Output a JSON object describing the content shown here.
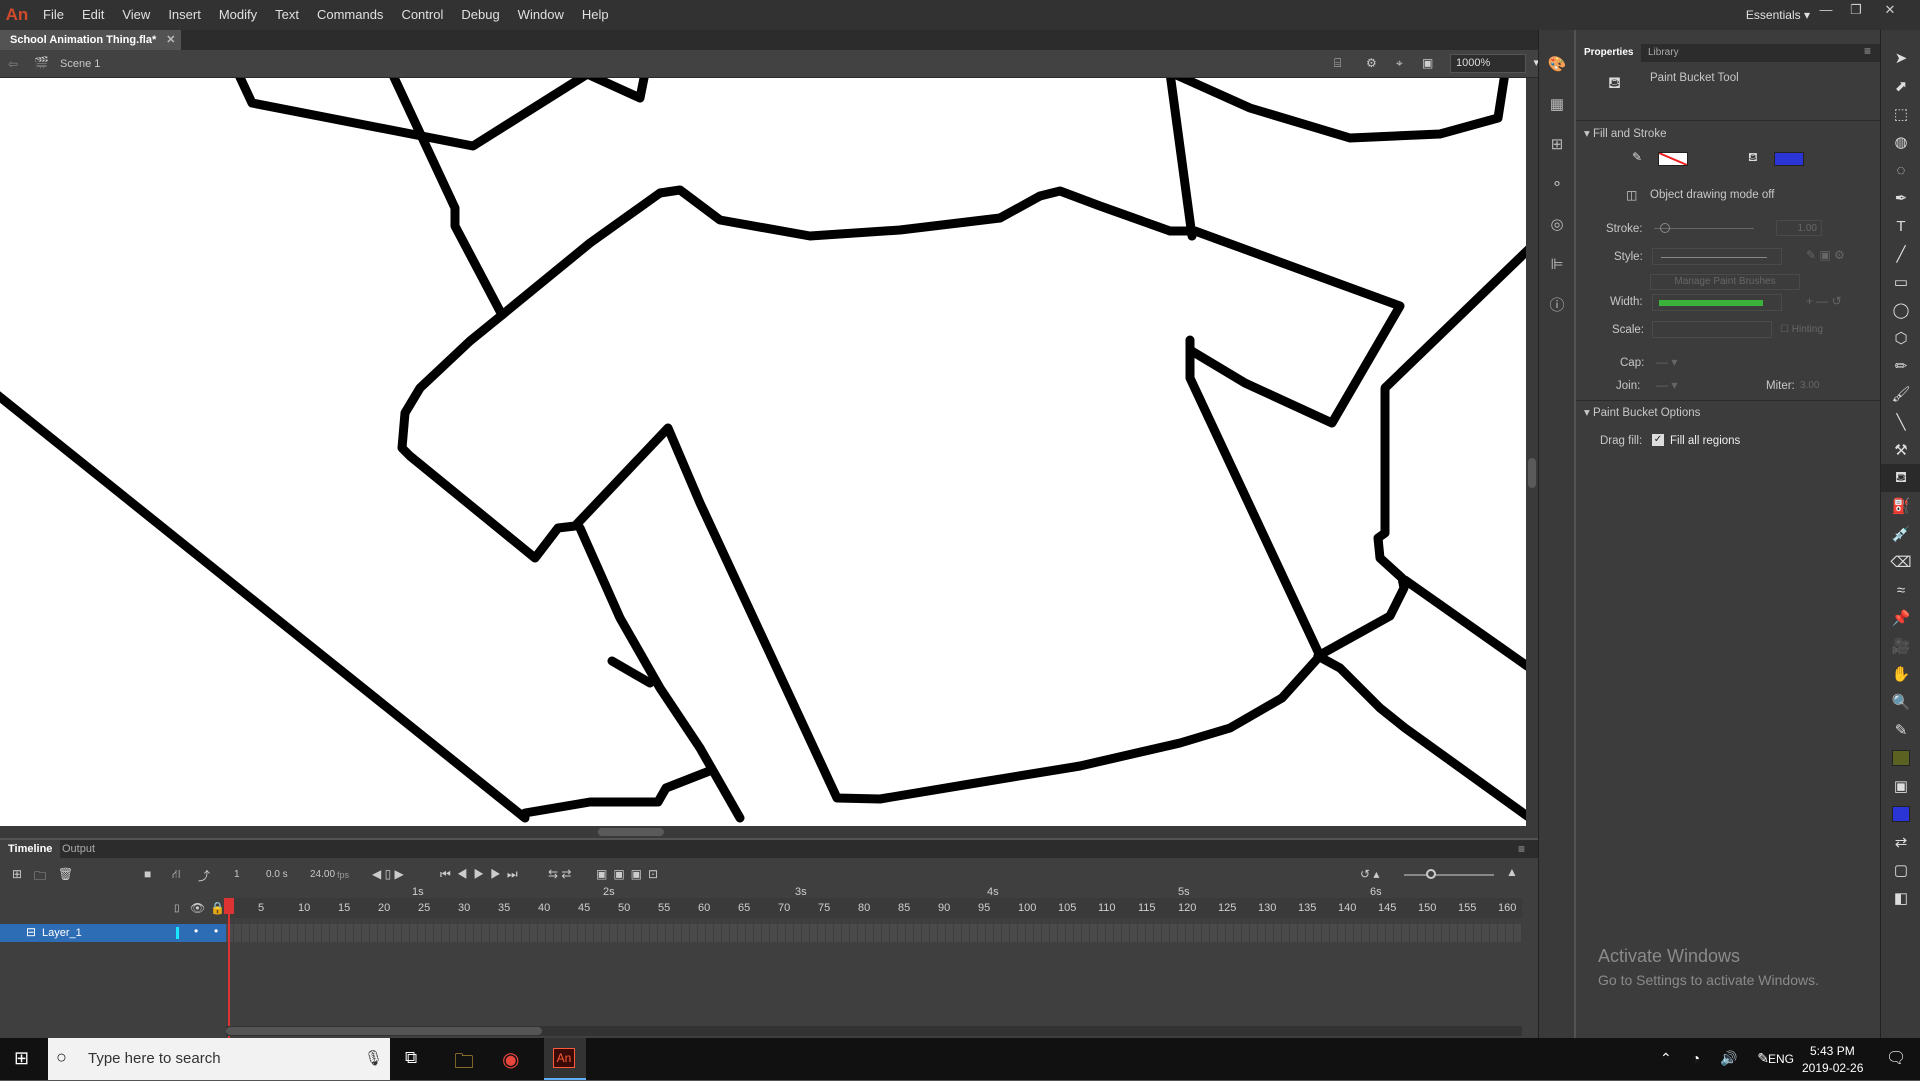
{
  "menu": {
    "logo": "An",
    "items": [
      "File",
      "Edit",
      "View",
      "Insert",
      "Modify",
      "Text",
      "Commands",
      "Control",
      "Debug",
      "Window",
      "Help"
    ],
    "workspace": "Essentials"
  },
  "document": {
    "tab": "School Animation Thing.fla*",
    "scene": "Scene 1",
    "zoom": "1000%"
  },
  "timeline": {
    "tabs": [
      "Timeline",
      "Output"
    ],
    "current_frame": "1",
    "time": "0.0 s",
    "fps": "24.00",
    "fps_unit": "fps",
    "layer": "Layer_1",
    "ticks": [
      "1",
      "5",
      "10",
      "15",
      "20",
      "25",
      "30",
      "35",
      "40",
      "45",
      "50",
      "55",
      "60",
      "65",
      "70",
      "75",
      "80",
      "85",
      "90",
      "95",
      "100",
      "105",
      "110",
      "115",
      "120",
      "125",
      "130",
      "135",
      "140",
      "145",
      "150",
      "155",
      "160"
    ],
    "seconds": [
      "1s",
      "2s",
      "3s",
      "4s",
      "5s",
      "6s"
    ]
  },
  "properties": {
    "tabs": [
      "Properties",
      "Library"
    ],
    "tool_name": "Paint Bucket Tool",
    "section_fill": "Fill and Stroke",
    "object_mode": "Object drawing mode off",
    "stroke_label": "Stroke:",
    "stroke_value": "1.00",
    "style_label": "Style:",
    "manage_brushes": "Manage Paint Brushes",
    "width_label": "Width:",
    "scale_label": "Scale:",
    "hinting": "Hinting",
    "cap_label": "Cap:",
    "join_label": "Join:",
    "miter_label": "Miter:",
    "miter_value": "3.00",
    "section_bucket": "Paint Bucket Options",
    "drag_fill_label": "Drag fill:",
    "fill_all": "Fill all regions",
    "fill_color": "#2b35d6",
    "tool_fill_color": "#5b6120",
    "tool_fill_color2": "#2b35d6"
  },
  "watermark": {
    "title": "Activate Windows",
    "sub": "Go to Settings to activate Windows."
  },
  "taskbar": {
    "search_placeholder": "Type here to search",
    "lang": "ENG",
    "time": "5:43 PM",
    "date": "2019-02-26"
  }
}
